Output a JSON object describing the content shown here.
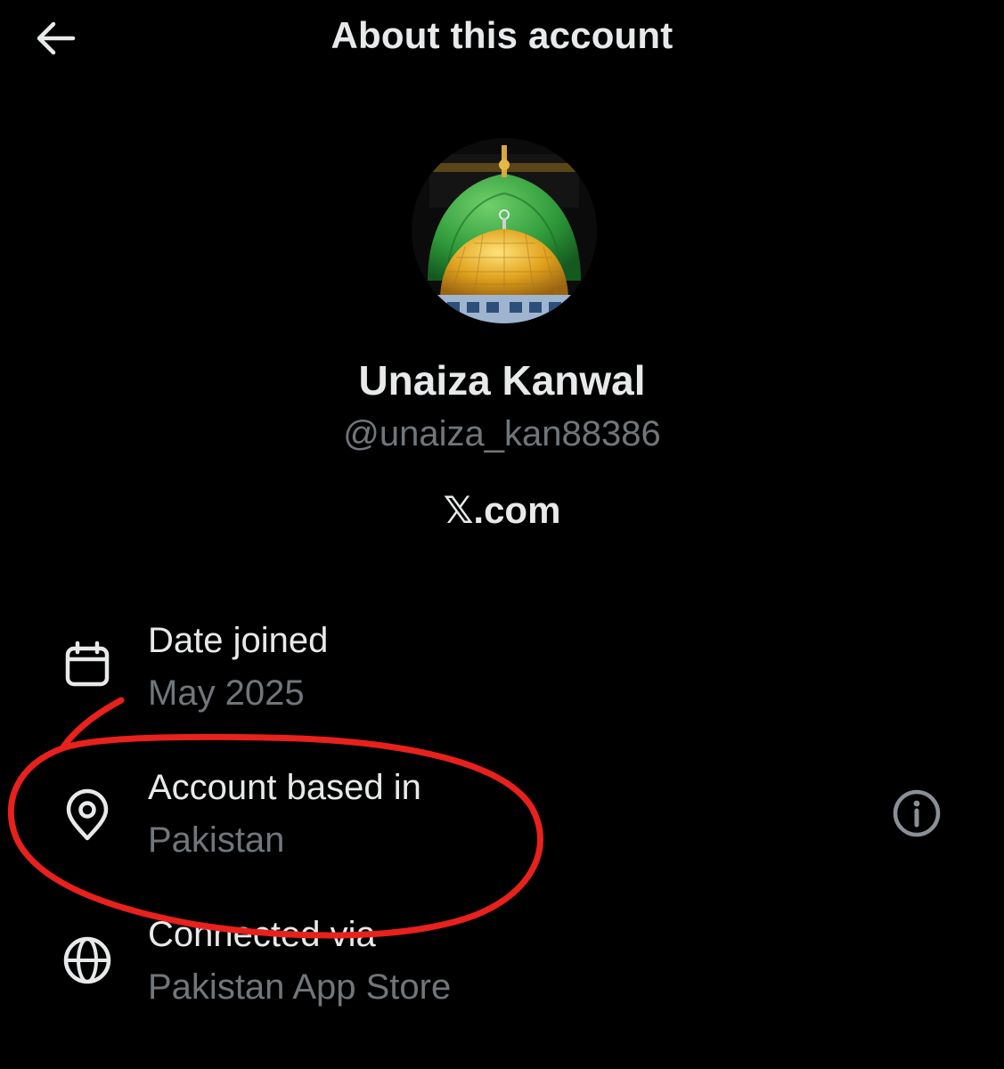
{
  "header": {
    "title": "About this account",
    "back_icon": "arrow-left-icon"
  },
  "profile": {
    "display_name": "Unaiza Kanwal",
    "handle": "@unaiza_kan88386",
    "platform": "𝕏.com",
    "avatar": "green-and-golden-dome-image"
  },
  "rows": [
    {
      "icon": "calendar-icon",
      "label": "Date joined",
      "value": "May 2025"
    },
    {
      "icon": "location-pin-icon",
      "label": "Account based in",
      "value": "Pakistan",
      "trailing_icon": "info-icon"
    },
    {
      "icon": "globe-icon",
      "label": "Connected via",
      "value": "Pakistan App Store"
    }
  ],
  "annotation": {
    "color": "#e8211d",
    "shape": "hand-drawn circle around Account based in row"
  },
  "colors": {
    "background": "#000000",
    "primary_text": "#e7e9ea",
    "secondary_text": "#71767b"
  }
}
